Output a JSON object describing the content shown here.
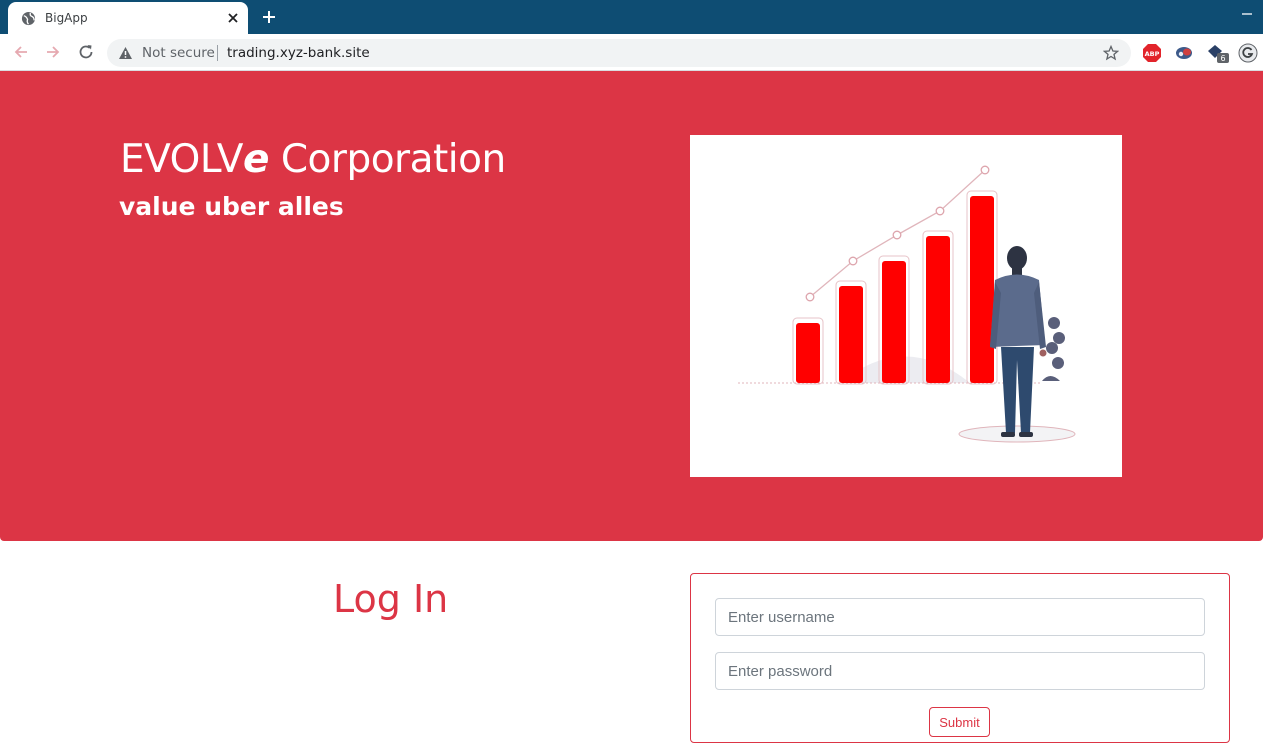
{
  "browser": {
    "tab_title": "BigApp",
    "security_label": "Not secure",
    "url": "trading.xyz-bank.site",
    "ext_badge": "6"
  },
  "hero": {
    "brand_prefix": "EVOLV",
    "brand_e": "e",
    "brand_suffix": " Corporation",
    "tagline": "value uber alles",
    "illustration": "growth-chart-businessman"
  },
  "login": {
    "title": "Log In",
    "username_placeholder": "Enter username",
    "password_placeholder": "Enter password",
    "submit_label": "Submit"
  },
  "colors": {
    "accent": "#dc3545",
    "tabbar": "#0e4d73"
  }
}
